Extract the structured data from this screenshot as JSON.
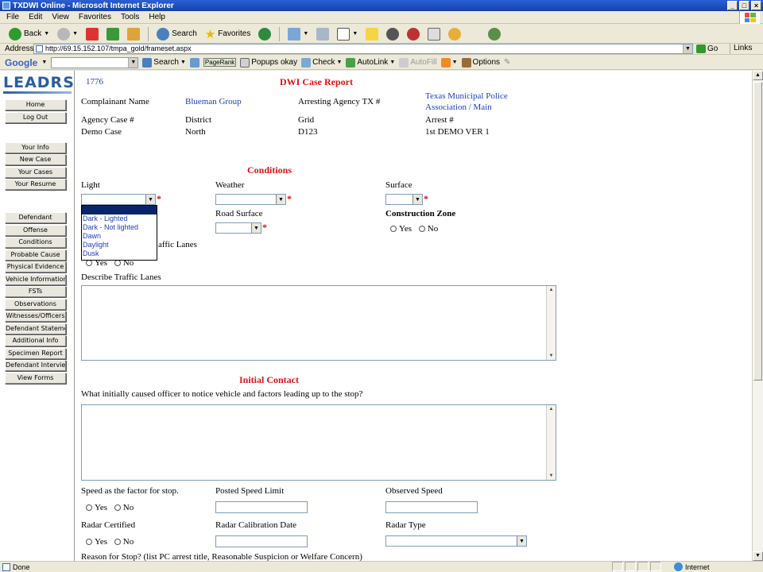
{
  "window": {
    "title": "TXDWI Online - Microsoft Internet Explorer"
  },
  "menu": [
    "File",
    "Edit",
    "View",
    "Favorites",
    "Tools",
    "Help"
  ],
  "toolbar": {
    "back": "Back",
    "search": "Search",
    "favorites": "Favorites"
  },
  "address": {
    "label": "Address",
    "url": "http://69.15.152.107/tmpa_gold/frameset.aspx",
    "go": "Go",
    "links": "Links"
  },
  "googlebar": {
    "logo": "Google",
    "search": "Search",
    "pagerank": "PageRank",
    "popups": "Popups okay",
    "check": "Check",
    "autolink": "AutoLink",
    "autofill": "AutoFill",
    "options": "Options"
  },
  "sidebar": {
    "logo": "LEADRS",
    "buttons": [
      "Home",
      "Log Out",
      "Your Info",
      "New Case",
      "Your Cases",
      "Your Resume",
      "Defendant",
      "Offense",
      "Conditions",
      "Probable Cause",
      "Physical Evidence",
      "Vehicle Information",
      "FSTs",
      "Observations",
      "Witnesses/Officers",
      "Defendant Statement",
      "Additional Info",
      "Specimen Report",
      "Defendant Interview",
      "View Forms"
    ]
  },
  "report": {
    "case_number": "1776",
    "title": "DWI Case Report",
    "complainant_label": "Complainant Name",
    "complainant_value": "Blueman Group",
    "arresting_label": "Arresting Agency TX #",
    "arresting_value_1": "Texas Municipal Police",
    "arresting_value_2": "Association / Main",
    "agency_case_label": "Agency Case #",
    "district_label": "District",
    "grid_label": "Grid",
    "arrest_label": "Arrest #",
    "agency_case_value": "Demo Case",
    "district_value": "North",
    "grid_value": "D123",
    "arrest_value": "1st DEMO VER 1"
  },
  "conditions": {
    "title": "Conditions",
    "light_label": "Light",
    "weather_label": "Weather",
    "surface_label": "Surface",
    "road_surface_label": "Road Surface",
    "construction_label": "Construction Zone",
    "traffic_lanes_label": "affic Lanes",
    "yes": "Yes",
    "no": "No",
    "describe_label": "Describe Traffic Lanes",
    "light_options": [
      "",
      "Dark - Lighted",
      "Dark - Not lighted",
      "Dawn",
      "Daylight",
      "Dusk"
    ],
    "required_mark": "*"
  },
  "initial_contact": {
    "title": "Initial Contact",
    "question": "What initially caused officer to notice vehicle and factors leading up to the stop?",
    "speed_factor_label": "Speed as the factor for stop.",
    "posted_label": "Posted Speed Limit",
    "observed_label": "Observed Speed",
    "radar_cert_label": "Radar Certified",
    "radar_cal_label": "Radar Calibration Date",
    "radar_type_label": "Radar Type",
    "reason_label": "Reason for Stop? (list PC arrest title, Reasonable Suspicion or Welfare Concern)"
  },
  "status": {
    "text": "Done",
    "zone": "Internet"
  },
  "colors": {
    "accent_blue": "#1c3fbf",
    "title_red": "#dd1111",
    "titlebar": "#2a5fd6"
  }
}
